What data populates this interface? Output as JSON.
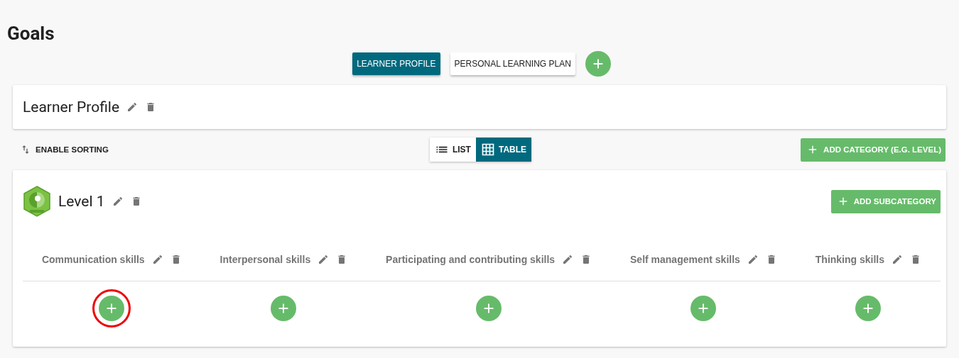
{
  "page_title": "Goals",
  "tabs": [
    {
      "label": "LEARNER PROFILE",
      "selected": true
    },
    {
      "label": "PERSONAL LEARNING PLAN",
      "selected": false
    }
  ],
  "profile": {
    "title": "Learner Profile"
  },
  "toolbar": {
    "sorting": "ENABLE SORTING",
    "views": [
      {
        "label": "LIST",
        "kind": "list",
        "selected": false
      },
      {
        "label": "TABLE",
        "kind": "table",
        "selected": true
      }
    ],
    "add_category": "ADD CATEGORY (E.G. LEVEL)"
  },
  "level": {
    "title": "Level 1",
    "add_subcategory": "ADD SUBCATEGORY",
    "columns": [
      {
        "name": "Communication skills",
        "highlighted": true
      },
      {
        "name": "Interpersonal skills",
        "highlighted": false
      },
      {
        "name": "Participating and contributing skills",
        "highlighted": false
      },
      {
        "name": "Self management skills",
        "highlighted": false
      },
      {
        "name": "Thinking skills",
        "highlighted": false
      }
    ]
  }
}
